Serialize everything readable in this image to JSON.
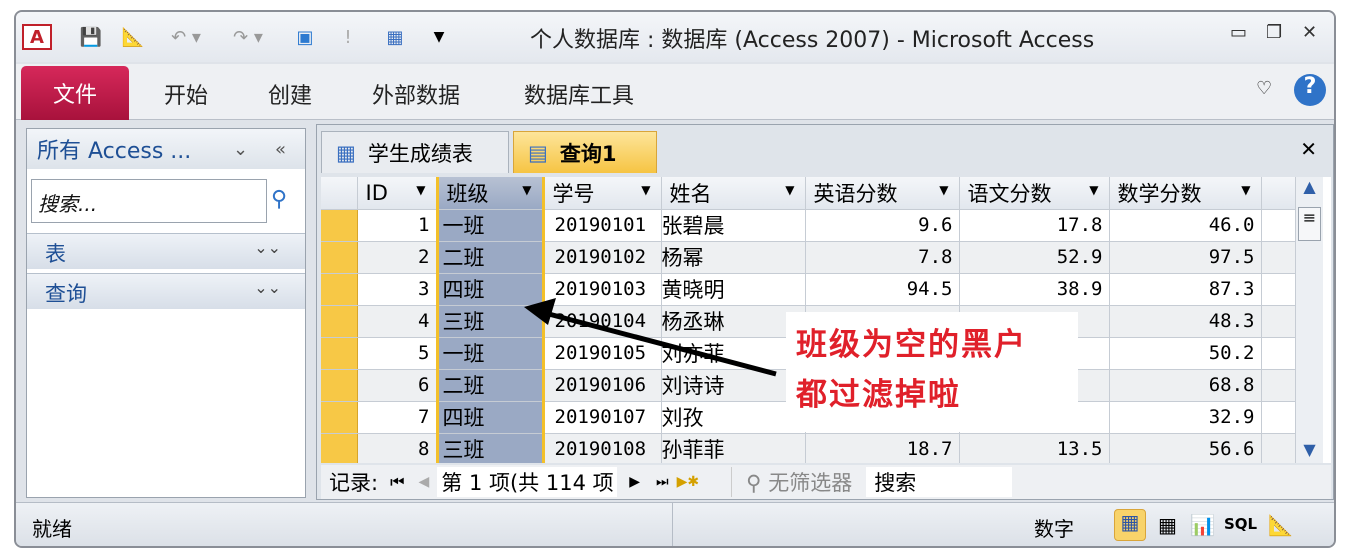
{
  "titlebar": {
    "title": "个人数据库 : 数据库 (Access 2007)  -  Microsoft Access",
    "app_icon": "A"
  },
  "ribbon": {
    "tabs": [
      "文件",
      "开始",
      "创建",
      "外部数据",
      "数据库工具"
    ]
  },
  "nav": {
    "header": "所有 Access ...",
    "search_placeholder": "搜索...",
    "groups": [
      "表",
      "查询"
    ]
  },
  "doc_tabs": [
    "学生成绩表",
    "查询1"
  ],
  "grid": {
    "columns": [
      "ID",
      "班级",
      "学号",
      "姓名",
      "英语分数",
      "语文分数",
      "数学分数"
    ],
    "rows": [
      [
        "1",
        "一班",
        "20190101",
        "张碧晨",
        "9.6",
        "17.8",
        "46.0"
      ],
      [
        "2",
        "二班",
        "20190102",
        "杨幂",
        "7.8",
        "52.9",
        "97.5"
      ],
      [
        "3",
        "四班",
        "20190103",
        "黄晓明",
        "94.5",
        "38.9",
        "87.3"
      ],
      [
        "4",
        "三班",
        "20190104",
        "杨丞琳",
        "",
        "",
        "48.3"
      ],
      [
        "5",
        "一班",
        "20190105",
        "刘亦菲",
        "",
        "",
        "50.2"
      ],
      [
        "6",
        "二班",
        "20190106",
        "刘诗诗",
        "",
        "",
        "68.8"
      ],
      [
        "7",
        "四班",
        "20190107",
        "刘孜",
        "",
        "",
        "32.9"
      ],
      [
        "8",
        "三班",
        "20190108",
        "孙菲菲",
        "18.7",
        "13.5",
        "56.6"
      ]
    ]
  },
  "recnav": {
    "label": "记录:",
    "position": "第 1 项(共 114 项",
    "filter": "无筛选器",
    "search": "搜索"
  },
  "status": {
    "left": "就绪",
    "mode": "数字",
    "sql": "SQL"
  },
  "annotation": {
    "line1": "班级为空的黑户",
    "line2": "都过滤掉啦"
  },
  "colors": {
    "file_tab": "#c41e4e",
    "annotation": "#e0202a",
    "selector": "#f7c846"
  }
}
